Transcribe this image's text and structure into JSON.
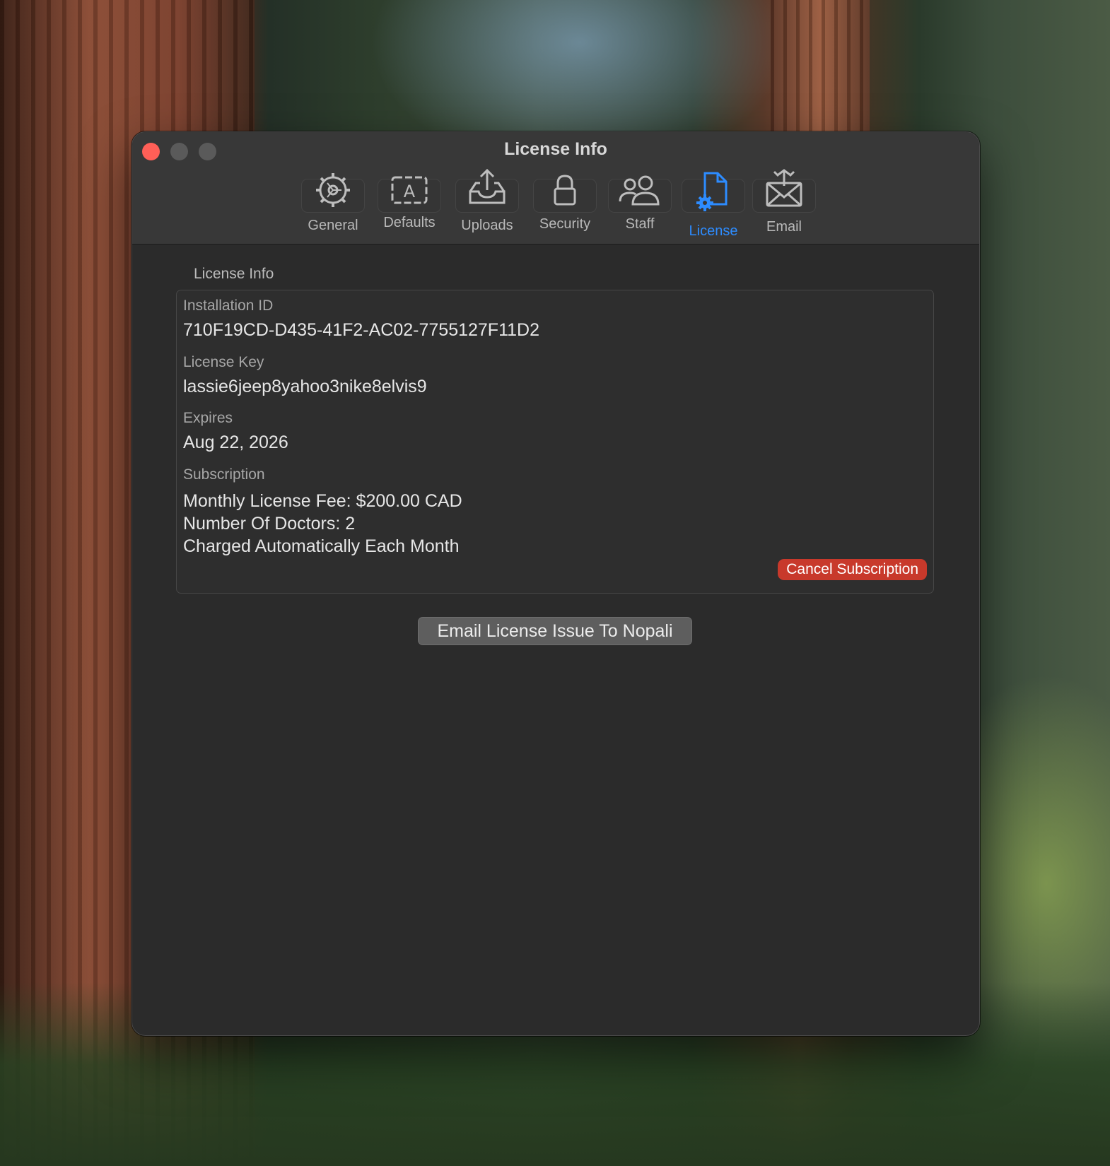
{
  "window": {
    "title": "License Info"
  },
  "toolbar": {
    "items": [
      {
        "label": "General",
        "icon": "gear-icon",
        "active": false
      },
      {
        "label": "Defaults",
        "icon": "text-box-icon",
        "active": false
      },
      {
        "label": "Uploads",
        "icon": "upload-tray-icon",
        "active": false
      },
      {
        "label": "Security",
        "icon": "lock-icon",
        "active": false
      },
      {
        "label": "Staff",
        "icon": "people-icon",
        "active": false
      },
      {
        "label": "License",
        "icon": "document-gear-icon",
        "active": true
      },
      {
        "label": "Email",
        "icon": "envelope-icon",
        "active": false
      }
    ]
  },
  "license": {
    "group_label": "License Info",
    "installation_id_label": "Installation ID",
    "installation_id": "710F19CD-D435-41F2-AC02-7755127F11D2",
    "license_key_label": "License Key",
    "license_key": "lassie6jeep8yahoo3nike8elvis9",
    "expires_label": "Expires",
    "expires": "Aug 22, 2026",
    "subscription_label": "Subscription",
    "subscription_lines": [
      "Monthly License Fee: $200.00 CAD",
      "Number Of Doctors: 2",
      "Charged Automatically Each Month"
    ],
    "cancel_label": "Cancel Subscription"
  },
  "actions": {
    "email_issue_label": "Email License Issue To Nopali"
  },
  "colors": {
    "accent": "#2d8cff",
    "danger": "#c8392b",
    "close": "#ff5f57"
  }
}
